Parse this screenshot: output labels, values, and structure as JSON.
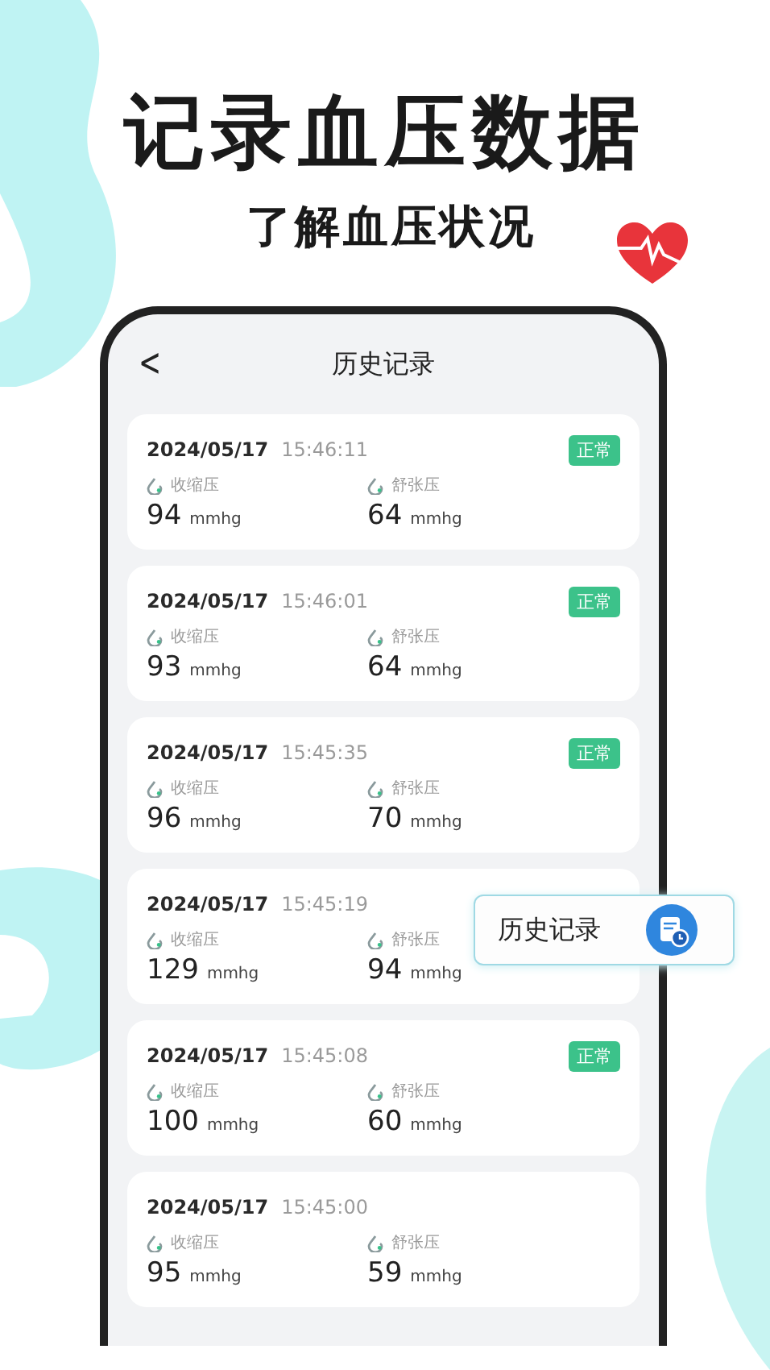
{
  "headline": "记录血压数据",
  "subtitle": "了解血压状况",
  "screen": {
    "back": "<",
    "title": "历史记录"
  },
  "records": [
    {
      "date": "2024/05/17",
      "time": "15:46:11",
      "status": "正常",
      "readings": [
        {
          "label": "收缩压",
          "value": "94",
          "unit": "mmhg"
        },
        {
          "label": "舒张压",
          "value": "64",
          "unit": "mmhg"
        }
      ]
    },
    {
      "date": "2024/05/17",
      "time": "15:46:01",
      "status": "正常",
      "readings": [
        {
          "label": "收缩压",
          "value": "93",
          "unit": "mmhg"
        },
        {
          "label": "舒张压",
          "value": "64",
          "unit": "mmhg"
        }
      ]
    },
    {
      "date": "2024/05/17",
      "time": "15:45:35",
      "status": "正常",
      "readings": [
        {
          "label": "收缩压",
          "value": "96",
          "unit": "mmhg"
        },
        {
          "label": "舒张压",
          "value": "70",
          "unit": "mmhg"
        }
      ]
    },
    {
      "date": "2024/05/17",
      "time": "15:45:19",
      "readings": [
        {
          "label": "收缩压",
          "value": "129",
          "unit": "mmhg"
        },
        {
          "label": "舒张压",
          "value": "94",
          "unit": "mmhg"
        }
      ]
    },
    {
      "date": "2024/05/17",
      "time": "15:45:08",
      "status": "正常",
      "readings": [
        {
          "label": "收缩压",
          "value": "100",
          "unit": "mmhg"
        },
        {
          "label": "舒张压",
          "value": "60",
          "unit": "mmhg"
        }
      ]
    },
    {
      "date": "2024/05/17",
      "time": "15:45:00",
      "readings": [
        {
          "label": "收缩压",
          "value": "95",
          "unit": "mmhg"
        },
        {
          "label": "舒张压",
          "value": "59",
          "unit": "mmhg"
        }
      ]
    }
  ],
  "popup": {
    "label": "历史记录"
  }
}
